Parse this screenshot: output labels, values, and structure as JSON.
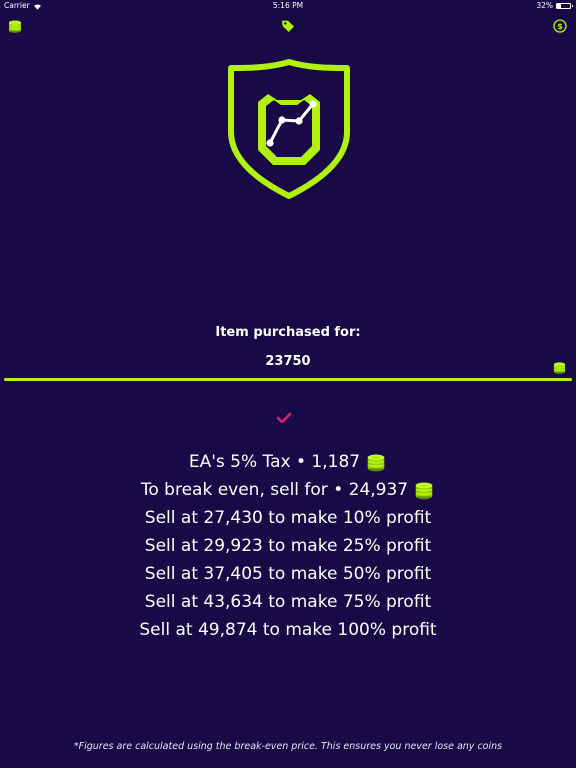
{
  "status_bar": {
    "carrier": "Carrier",
    "time": "5:16 PM",
    "battery_percent": "32%",
    "battery_level": 0.32
  },
  "colors": {
    "background": "#170a47",
    "accent": "#b2f10d",
    "check": "#e0216d",
    "text": "#ffffff"
  },
  "toolbar": {
    "left_icon": "coin-stack-icon",
    "center_icon": "price-tag-icon",
    "right_icon": "dollar-circle-icon"
  },
  "logo_icon": "shield-chart-icon",
  "purchase": {
    "label": "Item purchased for:",
    "value": "23750"
  },
  "results": {
    "tax": "EA's 5% Tax • 1,187",
    "break_even": "To break even, sell for • 24,937",
    "profit_lines": [
      "Sell at 27,430 to make 10% profit",
      "Sell at 29,923 to make 25% profit",
      "Sell at 37,405 to make 50% profit",
      "Sell at 43,634 to make 75% profit",
      "Sell at 49,874 to make 100% profit"
    ]
  },
  "footnote": "*Figures are calculated using the break-even price. This ensures you never lose any coins"
}
